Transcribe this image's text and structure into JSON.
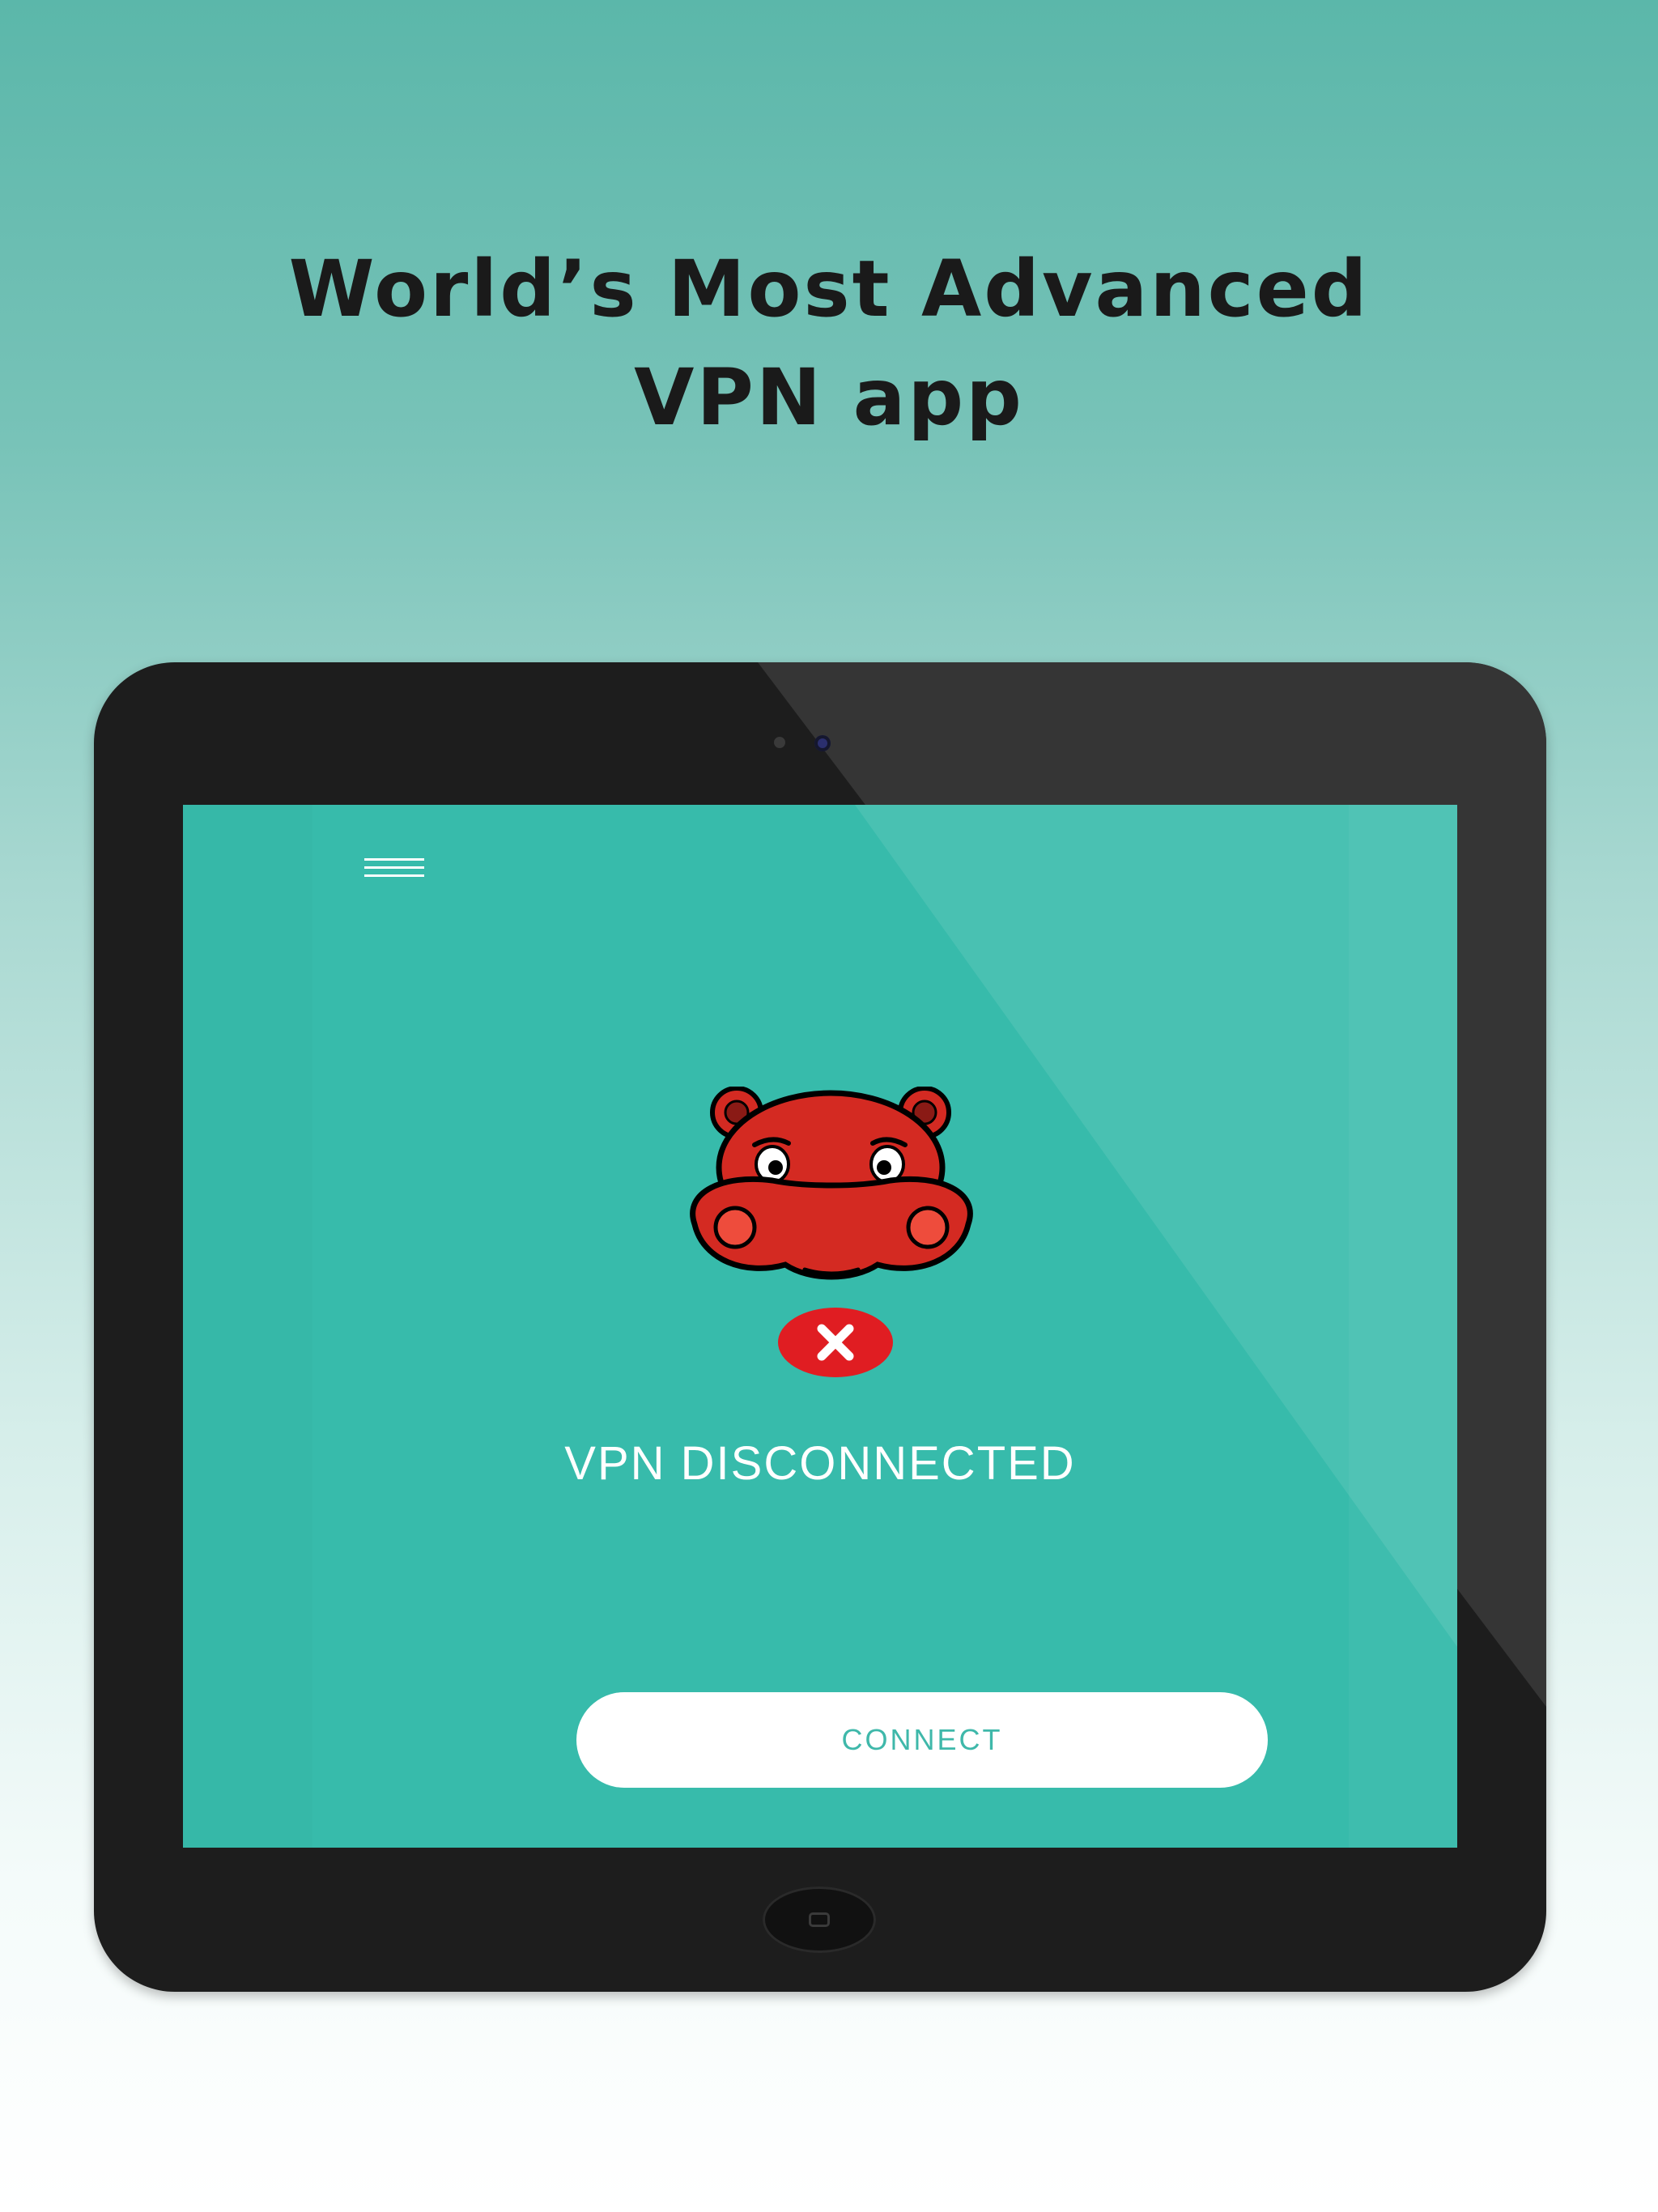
{
  "headline": {
    "line1": "World’s Most Advanced",
    "line2": "VPN app"
  },
  "app": {
    "menu_icon": "hamburger-menu-icon",
    "mascot_icon": "hippo-mascot-icon",
    "status_icon": "close-x-icon",
    "status_text": "VPN DISCONNECTED",
    "connect_label": "CONNECT"
  },
  "colors": {
    "screen_teal": "#37bbab",
    "status_red": "#e01d22",
    "mascot_red": "#d42a22",
    "device_body": "#1d1d1d",
    "button_text": "#3fb8aa"
  }
}
